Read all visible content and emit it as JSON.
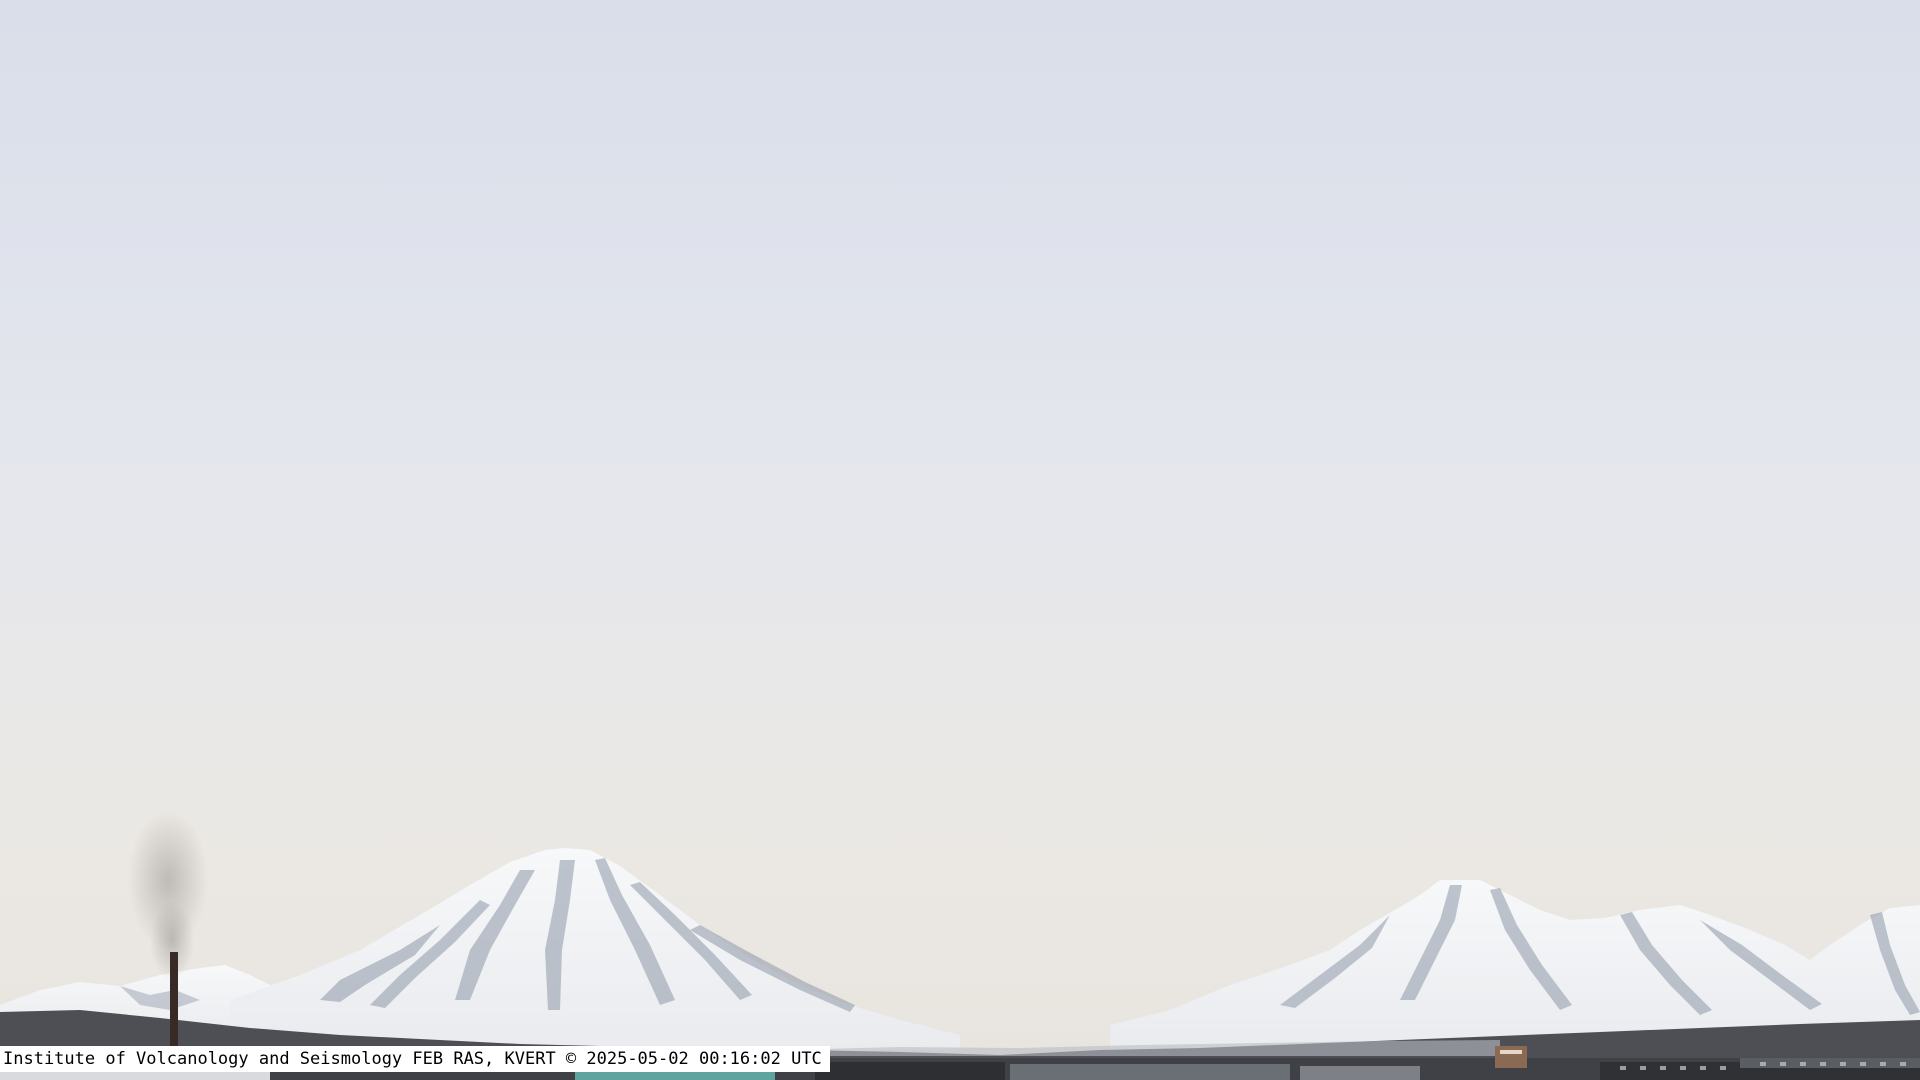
{
  "caption": {
    "text": "Institute of Volcanology and Seismology FEB RAS, KVERT © 2025-05-02 00:16:02 UTC"
  },
  "colors": {
    "sky_top": "#dadfeb",
    "sky_mid": "#e6e7ec",
    "sky_haze": "#ece8e2",
    "snow": "#f4f5f7",
    "rock_shadow": "#8d97a6",
    "foothills": "#4a4c52",
    "caption_bg": "#ffffff",
    "caption_text": "#000000"
  }
}
